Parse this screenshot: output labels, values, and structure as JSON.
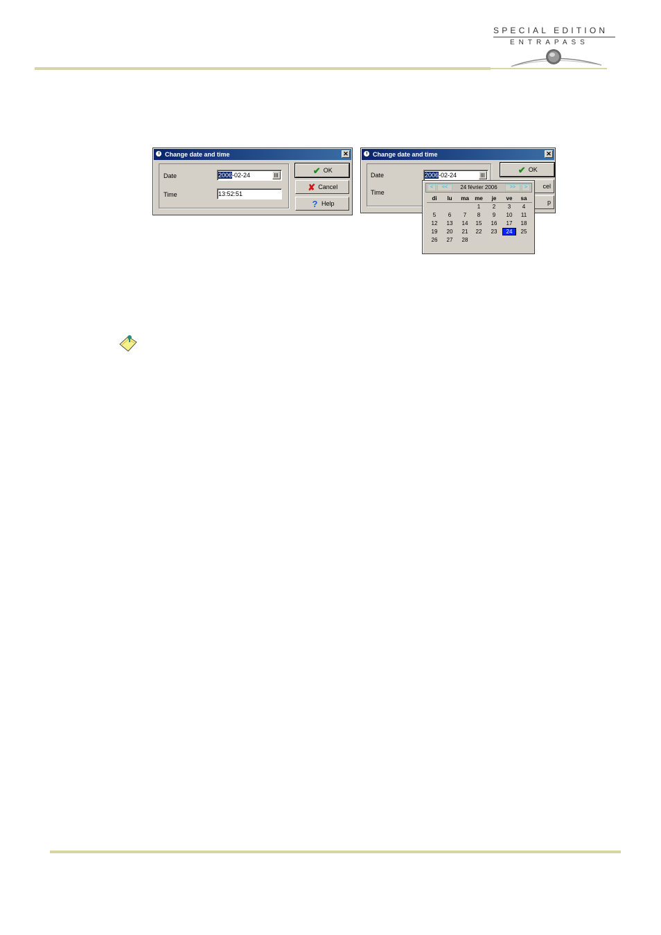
{
  "logo": {
    "line1": "SPECIAL EDITION",
    "line2": "ENTRAPASS"
  },
  "dialog_left": {
    "title": "Change date and time",
    "date_label": "Date",
    "date_selected": "2006",
    "date_rest": "-02-24",
    "time_label": "Time",
    "time_value": "13:52:51",
    "ok_label": "OK",
    "cancel_label": "Cancel",
    "help_label": "Help"
  },
  "dialog_right": {
    "title": "Change date and time",
    "date_label": "Date",
    "date_selected": "2006",
    "date_rest": "-02-24",
    "time_label": "Time",
    "ok_label": "OK",
    "cancel_partial": "cel",
    "help_partial": "p"
  },
  "calendar": {
    "header": "24 février 2006",
    "nav_prev": "<",
    "nav_prev_fast": "<<",
    "nav_next_fast": ">>",
    "nav_next": ">",
    "weekdays": [
      "di",
      "lu",
      "ma",
      "me",
      "je",
      "ve",
      "sa"
    ],
    "weeks": [
      [
        "",
        "",
        "",
        "1",
        "2",
        "3",
        "4"
      ],
      [
        "5",
        "6",
        "7",
        "8",
        "9",
        "10",
        "11"
      ],
      [
        "12",
        "13",
        "14",
        "15",
        "16",
        "17",
        "18"
      ],
      [
        "19",
        "20",
        "21",
        "22",
        "23",
        "24",
        "25"
      ],
      [
        "26",
        "27",
        "28",
        "",
        "",
        "",
        ""
      ]
    ],
    "selected_day": "24"
  },
  "icons": {
    "ok": "checkmark-icon",
    "cancel": "x-icon",
    "help": "question-icon",
    "note": "note-icon",
    "calendar": "calendar-icon",
    "clock": "clock-icon"
  },
  "colors": {
    "titlebar": "#0a246a",
    "rule": "#d8d6a6",
    "selection": "#0a24ff"
  }
}
